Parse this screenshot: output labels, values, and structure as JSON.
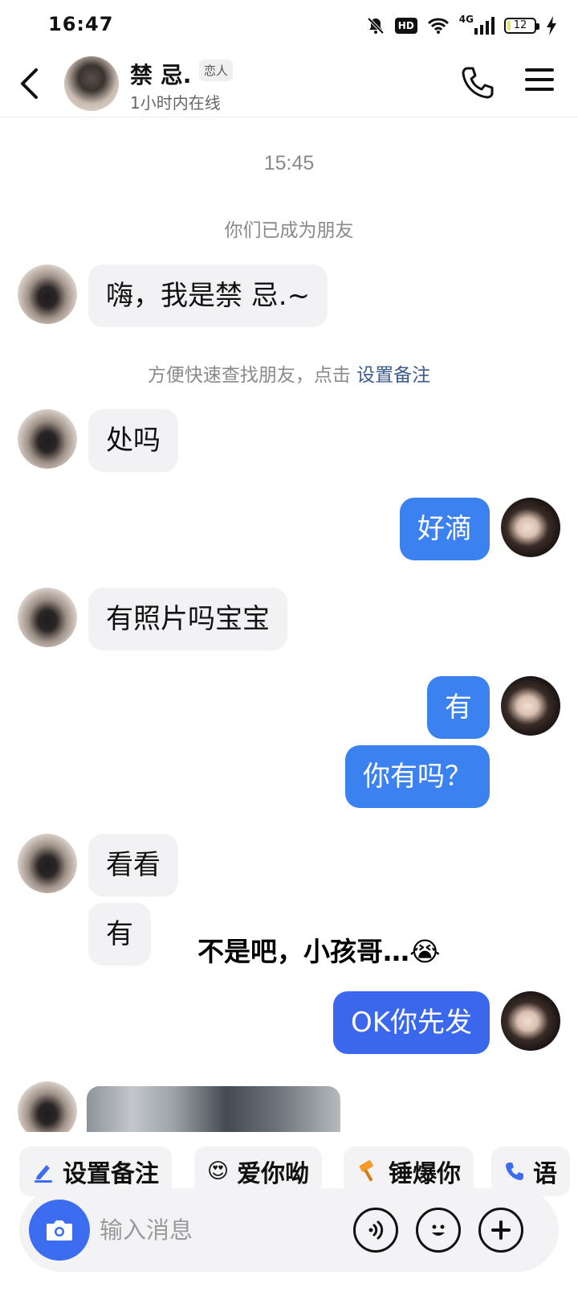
{
  "status_bar": {
    "time": "16:47",
    "hd_label": "HD",
    "network": "4G",
    "battery_level": "12",
    "battery_fraction": 0.12
  },
  "header": {
    "name": "禁  忌.",
    "relation_badge": "恋人",
    "online_status": "1小时内在线"
  },
  "chat": {
    "timestamp": "15:45",
    "system_message": "你们已成为朋友",
    "hint_text": "方便快速查找朋友，点击 ",
    "hint_link": "设置备注",
    "messages": [
      {
        "from": "other",
        "text": "嗨，我是禁  忌.~"
      },
      {
        "from": "other",
        "text": "处吗"
      },
      {
        "from": "self",
        "text": "好滴"
      },
      {
        "from": "other",
        "text": "有照片吗宝宝"
      },
      {
        "from": "self",
        "text": "有"
      },
      {
        "from": "self",
        "text": "你有吗？"
      },
      {
        "from": "other",
        "text": "看看"
      },
      {
        "from": "other",
        "text": "有"
      },
      {
        "from": "self",
        "text": "OK你先发"
      }
    ],
    "overlay_caption": "不是吧，小孩哥…",
    "overlay_emoji": "😭"
  },
  "quick_actions": [
    {
      "icon": "pen-icon",
      "label": "设置备注"
    },
    {
      "icon": "heart-eyes-emoji",
      "label": "爱你呦"
    },
    {
      "icon": "hammer-icon",
      "label": "锤爆你"
    },
    {
      "icon": "phone-icon",
      "label": "语"
    }
  ],
  "input": {
    "placeholder": "输入消息"
  },
  "colors": {
    "outgoing_bubble": "#3b82f0",
    "incoming_bubble": "#f2f2f4",
    "camera_button": "#3c6df0"
  }
}
